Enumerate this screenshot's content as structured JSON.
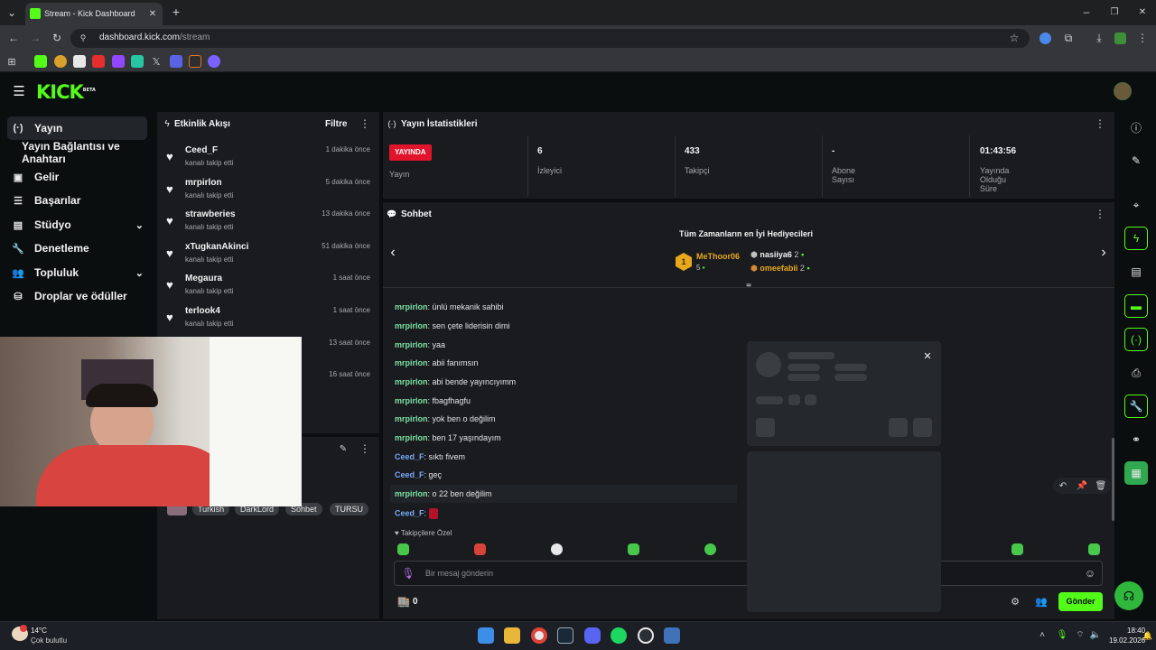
{
  "browser": {
    "tab_title": "Stream - Kick Dashboard",
    "url_domain": "dashboard.kick.com",
    "url_path": "/stream"
  },
  "header": {
    "logo": "KICK",
    "logo_badge": "BETA"
  },
  "sidebar": {
    "items": [
      {
        "label": "Yayın",
        "icon": "broadcast-icon"
      },
      {
        "label": "Yayın Bağlantısı ve Anahtarı"
      },
      {
        "label": "Gelir",
        "icon": "revenue-icon"
      },
      {
        "label": "Başarılar",
        "icon": "list-icon"
      },
      {
        "label": "Stüdyo",
        "icon": "studio-icon"
      },
      {
        "label": "Denetleme",
        "icon": "wrench-icon"
      },
      {
        "label": "Topluluk",
        "icon": "community-icon"
      },
      {
        "label": "Droplar ve ödüller",
        "icon": "drops-icon"
      }
    ]
  },
  "activity": {
    "title": "Etkinlik Akışı",
    "filter": "Filtre",
    "items": [
      {
        "name": "Ceed_F",
        "sub": "kanalı takip etti",
        "time": "1 dakika önce"
      },
      {
        "name": "mrpirlon",
        "sub": "kanalı takip etti",
        "time": "5 dakika önce"
      },
      {
        "name": "strawberies",
        "sub": "kanalı takip etti",
        "time": "13 dakika önce"
      },
      {
        "name": "xTugkanAkinci",
        "sub": "kanalı takip etti",
        "time": "51 dakika önce"
      },
      {
        "name": "Megaura",
        "sub": "kanalı takip etti",
        "time": "1 saat önce"
      },
      {
        "name": "terlook4",
        "sub": "kanalı takip etti",
        "time": "1 saat önce"
      },
      {
        "time": "13 saat önce"
      },
      {
        "time": "16 saat önce"
      }
    ]
  },
  "tags": [
    "Turkish",
    "DarkLord",
    "Sohbet",
    "TURSU"
  ],
  "stats": {
    "title": "Yayın İstatistikleri",
    "live_badge": "YAYINDA",
    "live_label": "Yayın",
    "items": [
      {
        "value": "6",
        "label": "İzleyici"
      },
      {
        "value": "433",
        "label": "Takipçi"
      },
      {
        "value": "-",
        "label": "Abone Sayısı"
      },
      {
        "value": "01:43:56",
        "label": "Yayında Olduğu Süre"
      }
    ]
  },
  "chat": {
    "title": "Sohbet",
    "gifters_title": "Tüm Zamanların en İyi Hediyecileri",
    "top_gifter": {
      "rank": "1",
      "name": "MeThoor06",
      "count": "5"
    },
    "gifters": [
      {
        "name": "nasiiya6",
        "count": "2"
      },
      {
        "name": "omeefabii",
        "count": "2"
      }
    ],
    "messages": [
      {
        "user": "mrpirlon",
        "text": ": ünlü mekanik sahibi"
      },
      {
        "user": "mrpirlon",
        "text": ": sen çete liderisin dimi"
      },
      {
        "user": "mrpirlon",
        "text": ": yaa"
      },
      {
        "user": "mrpirlon",
        "text": ": abii fanımsın"
      },
      {
        "user": "mrpirlon",
        "text": ": abi bende yayıncıyımm"
      },
      {
        "user": "mrpirlon",
        "text": ": fbagfhagfu"
      },
      {
        "user": "mrpirlon",
        "text": ": yok ben o değilim"
      },
      {
        "user": "mrpirlon",
        "text": ": ben 17 yaşındayım"
      },
      {
        "user": "Ceed_F",
        "text": ": sıktı fivem"
      },
      {
        "user": "Ceed_F",
        "text": ": geç"
      },
      {
        "user": "mrpirlon",
        "text": ": o 22 ben değilim"
      },
      {
        "user": "Ceed_F",
        "text": ":"
      }
    ],
    "follower_only": "Takipçilere Özel",
    "input_placeholder": "Bir mesaj gönderin",
    "points": "0",
    "send": "Gönder"
  },
  "taskbar": {
    "temp": "14°C",
    "weather": "Çok bulutlu",
    "time": "18:40",
    "date": "19.02.2026"
  },
  "colors": {
    "accent": "#53fc18",
    "live": "#e0142b",
    "chat_user_green": "#7ee3a4",
    "chat_user_blue": "#79a9f5"
  }
}
